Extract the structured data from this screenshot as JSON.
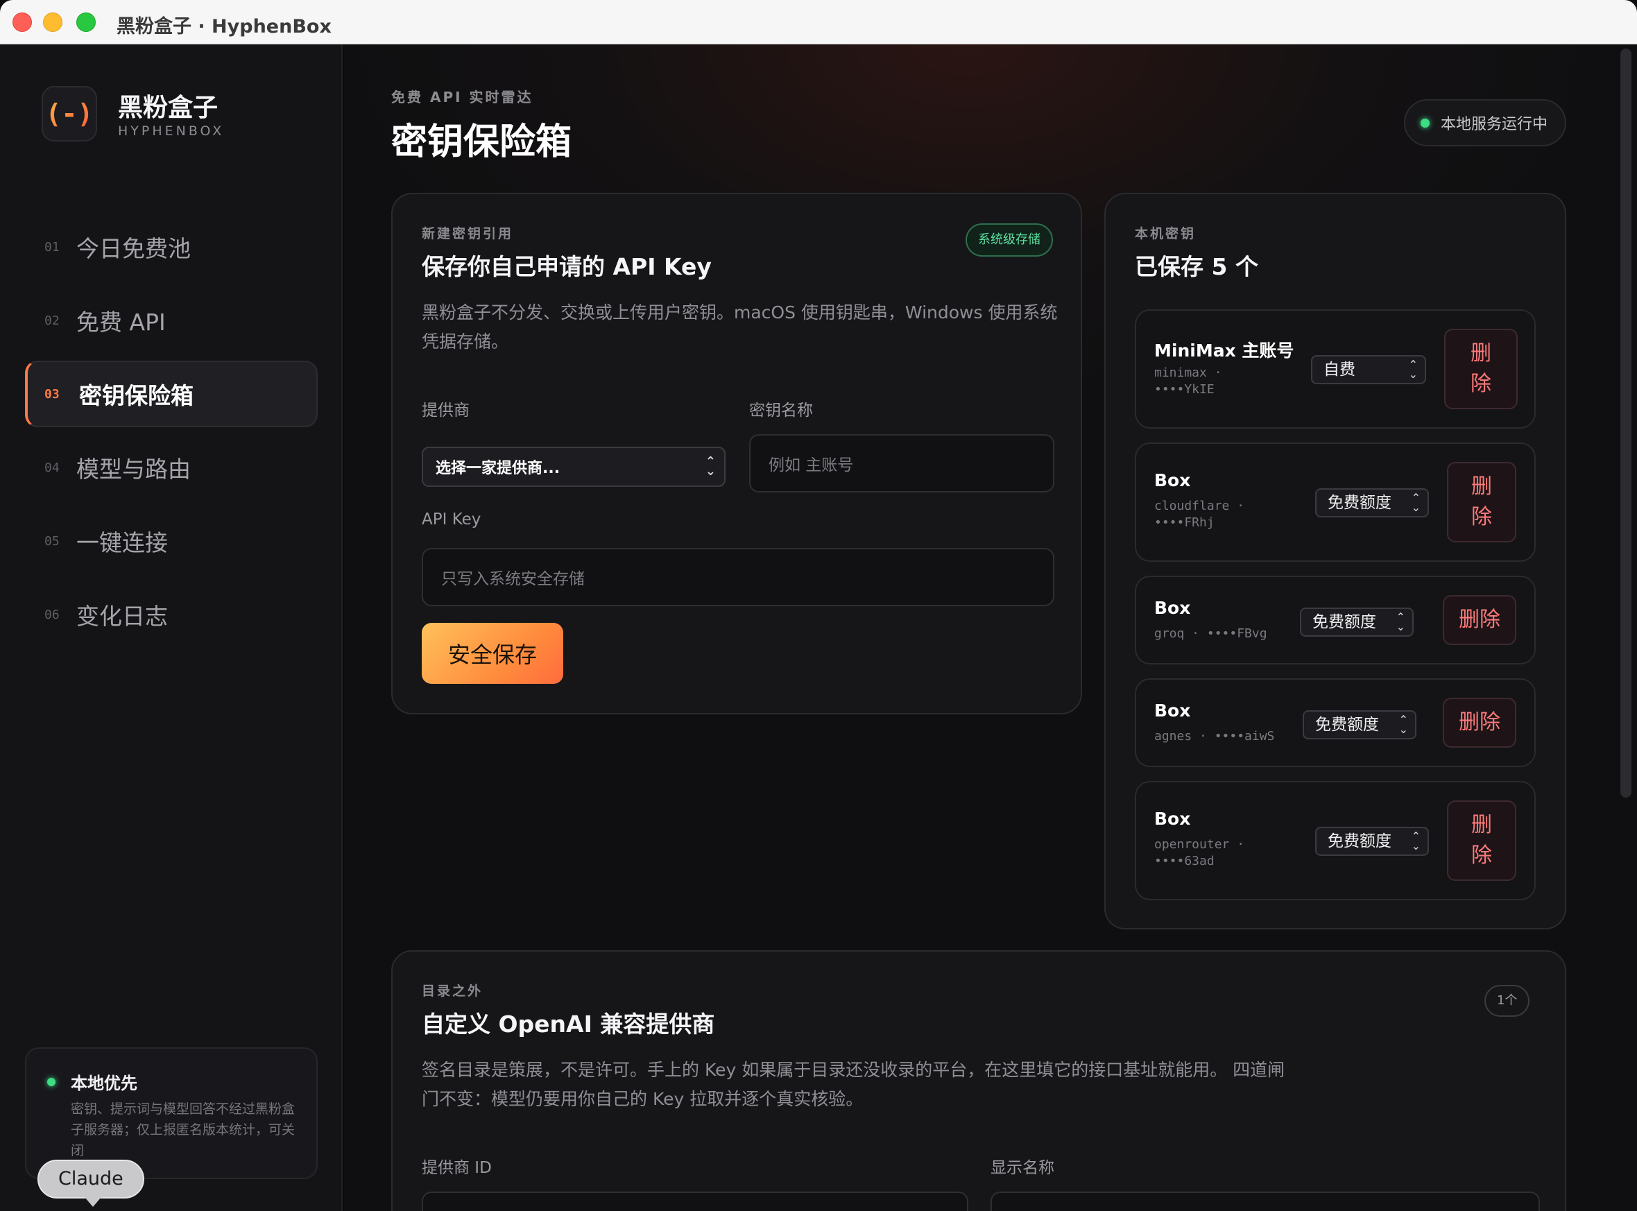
{
  "window": {
    "title": "黑粉盒子 · HyphenBox"
  },
  "brand": {
    "name": "黑粉盒子",
    "subtitle": "HYPHENBOX",
    "logo_glyph": "(-)",
    "accent": "#ff7a45"
  },
  "nav": {
    "items": [
      {
        "num": "01",
        "label": "今日免费池"
      },
      {
        "num": "02",
        "label": "免费 API"
      },
      {
        "num": "03",
        "label": "密钥保险箱",
        "active": true
      },
      {
        "num": "04",
        "label": "模型与路由"
      },
      {
        "num": "05",
        "label": "一键连接"
      },
      {
        "num": "06",
        "label": "变化日志"
      }
    ]
  },
  "local_first": {
    "title": "本地优先",
    "description": "密钥、提示词与模型回答不经过黑粉盒子服务器；仅上报匿名版本统计，可关闭"
  },
  "claude_label": "Claude",
  "header": {
    "eyebrow": "免费 API 实时雷达",
    "title": "密钥保险箱",
    "status": "本地服务运行中",
    "status_color": "#3ddc84"
  },
  "new_key": {
    "eyebrow": "新建密钥引用",
    "title": "保存你自己申请的 API Key",
    "badge": "系统级存储",
    "description_line1": "黑粉盒子不分发、交换或上传用户密钥。macOS 使用钥匙串，Windows 使用系统",
    "description_line2": "凭据存储。",
    "provider_label": "提供商",
    "provider_value": "选择一家提供商...",
    "key_name_label": "密钥名称",
    "key_name_placeholder": "例如 主账号",
    "api_key_label": "API Key",
    "api_key_placeholder": "只写入系统安全存储",
    "save_label": "安全保存"
  },
  "saved_keys": {
    "eyebrow": "本机密钥",
    "title": "已保存 5 个",
    "items": [
      {
        "name": "MiniMax 主账号",
        "meta1": "minimax ·",
        "meta2": "••••YkIE",
        "plan": "自费",
        "delete": "删除"
      },
      {
        "name": "Box",
        "meta1": "cloudflare ·",
        "meta2": "••••FRhj",
        "plan": "免费额度",
        "delete": "删除"
      },
      {
        "name": "Box",
        "meta1": "groq · ••••FBvg",
        "meta2": "",
        "plan": "免费额度",
        "delete": "删除"
      },
      {
        "name": "Box",
        "meta1": "agnes · ••••aiwS",
        "meta2": "",
        "plan": "免费额度",
        "delete": "删除"
      },
      {
        "name": "Box",
        "meta1": "openrouter ·",
        "meta2": "••••63ad",
        "plan": "免费额度",
        "delete": "删除"
      }
    ]
  },
  "custom_provider": {
    "eyebrow": "目录之外",
    "title": "自定义 OpenAI 兼容提供商",
    "count": "1个",
    "description_line1": "签名目录是策展，不是许可。手上的 Key 如果属于目录还没收录的平台，在这里填它的接口基址就能用。 四道闸",
    "description_line2": "门不变：模型仍要用你自己的 Key 拉取并逐个真实核验。",
    "provider_id_label": "提供商 ID",
    "display_name_label": "显示名称"
  }
}
